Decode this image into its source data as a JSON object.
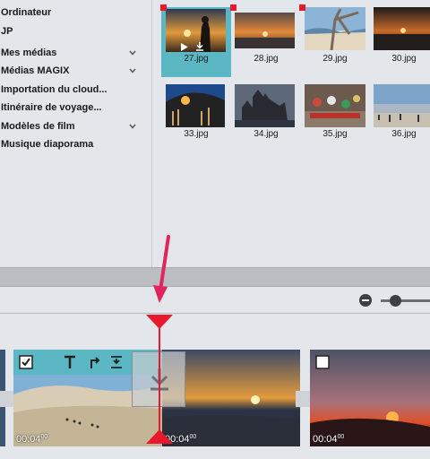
{
  "sidebar": {
    "items": [
      {
        "label": "Ordinateur",
        "expandable": false
      },
      {
        "label": "JP",
        "expandable": false
      },
      {
        "label": "Mes médias",
        "expandable": true
      },
      {
        "label": "Médias MAGIX",
        "expandable": true
      },
      {
        "label": "Importation du cloud...",
        "expandable": false
      },
      {
        "label": "Itinéraire de voyage...",
        "expandable": false
      },
      {
        "label": "Modèles de film",
        "expandable": true
      },
      {
        "label": "Musique diaporama",
        "expandable": false
      }
    ]
  },
  "media_grid": {
    "items": [
      {
        "name": "27.jpg",
        "selected": true,
        "marked": true
      },
      {
        "name": "28.jpg",
        "selected": false,
        "marked": true
      },
      {
        "name": "29.jpg",
        "selected": false,
        "marked": true
      },
      {
        "name": "30.jpg",
        "selected": false,
        "marked": false
      },
      {
        "name": "33.jpg",
        "selected": false,
        "marked": false
      },
      {
        "name": "34.jpg",
        "selected": false,
        "marked": false
      },
      {
        "name": "35.jpg",
        "selected": false,
        "marked": false
      },
      {
        "name": "36.jpg",
        "selected": false,
        "marked": false
      }
    ]
  },
  "timeline": {
    "clips": [
      {
        "timecode": "00:04",
        "frames": "00"
      },
      {
        "timecode": "00:04",
        "frames": "00"
      },
      {
        "timecode": "00:04",
        "frames": "00"
      }
    ]
  },
  "colors": {
    "selection": "#5bb7c4",
    "marker": "#e8192c",
    "playhead": "#e8192c",
    "annotation_arrow": "#e0245e"
  },
  "icons": [
    "chevron-down-icon",
    "play-icon",
    "download-icon",
    "checkbox-icon",
    "text-icon",
    "rotate-icon",
    "trim-icon",
    "zoom-out-icon"
  ]
}
